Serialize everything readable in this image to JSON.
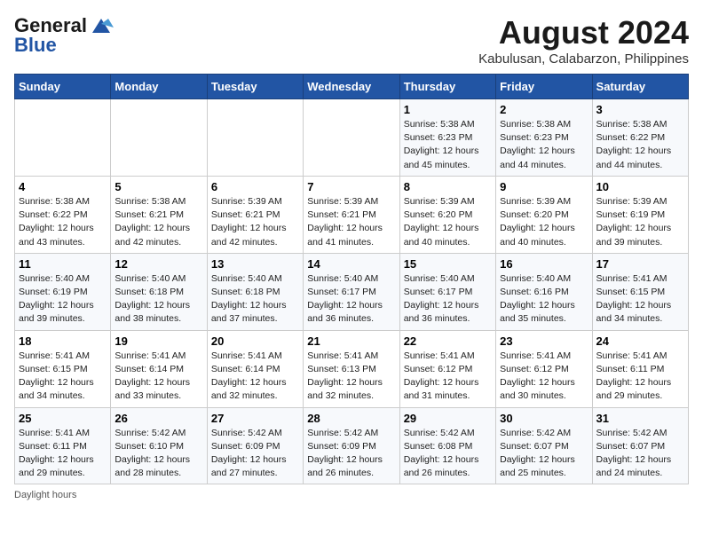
{
  "header": {
    "logo_general": "General",
    "logo_blue": "Blue",
    "month_title": "August 2024",
    "location": "Kabulusan, Calabarzon, Philippines"
  },
  "days_of_week": [
    "Sunday",
    "Monday",
    "Tuesday",
    "Wednesday",
    "Thursday",
    "Friday",
    "Saturday"
  ],
  "footer": {
    "daylight_hours": "Daylight hours"
  },
  "weeks": [
    [
      {
        "day": "",
        "info": ""
      },
      {
        "day": "",
        "info": ""
      },
      {
        "day": "",
        "info": ""
      },
      {
        "day": "",
        "info": ""
      },
      {
        "day": "1",
        "info": "Sunrise: 5:38 AM\nSunset: 6:23 PM\nDaylight: 12 hours\nand 45 minutes."
      },
      {
        "day": "2",
        "info": "Sunrise: 5:38 AM\nSunset: 6:23 PM\nDaylight: 12 hours\nand 44 minutes."
      },
      {
        "day": "3",
        "info": "Sunrise: 5:38 AM\nSunset: 6:22 PM\nDaylight: 12 hours\nand 44 minutes."
      }
    ],
    [
      {
        "day": "4",
        "info": "Sunrise: 5:38 AM\nSunset: 6:22 PM\nDaylight: 12 hours\nand 43 minutes."
      },
      {
        "day": "5",
        "info": "Sunrise: 5:38 AM\nSunset: 6:21 PM\nDaylight: 12 hours\nand 42 minutes."
      },
      {
        "day": "6",
        "info": "Sunrise: 5:39 AM\nSunset: 6:21 PM\nDaylight: 12 hours\nand 42 minutes."
      },
      {
        "day": "7",
        "info": "Sunrise: 5:39 AM\nSunset: 6:21 PM\nDaylight: 12 hours\nand 41 minutes."
      },
      {
        "day": "8",
        "info": "Sunrise: 5:39 AM\nSunset: 6:20 PM\nDaylight: 12 hours\nand 40 minutes."
      },
      {
        "day": "9",
        "info": "Sunrise: 5:39 AM\nSunset: 6:20 PM\nDaylight: 12 hours\nand 40 minutes."
      },
      {
        "day": "10",
        "info": "Sunrise: 5:39 AM\nSunset: 6:19 PM\nDaylight: 12 hours\nand 39 minutes."
      }
    ],
    [
      {
        "day": "11",
        "info": "Sunrise: 5:40 AM\nSunset: 6:19 PM\nDaylight: 12 hours\nand 39 minutes."
      },
      {
        "day": "12",
        "info": "Sunrise: 5:40 AM\nSunset: 6:18 PM\nDaylight: 12 hours\nand 38 minutes."
      },
      {
        "day": "13",
        "info": "Sunrise: 5:40 AM\nSunset: 6:18 PM\nDaylight: 12 hours\nand 37 minutes."
      },
      {
        "day": "14",
        "info": "Sunrise: 5:40 AM\nSunset: 6:17 PM\nDaylight: 12 hours\nand 36 minutes."
      },
      {
        "day": "15",
        "info": "Sunrise: 5:40 AM\nSunset: 6:17 PM\nDaylight: 12 hours\nand 36 minutes."
      },
      {
        "day": "16",
        "info": "Sunrise: 5:40 AM\nSunset: 6:16 PM\nDaylight: 12 hours\nand 35 minutes."
      },
      {
        "day": "17",
        "info": "Sunrise: 5:41 AM\nSunset: 6:15 PM\nDaylight: 12 hours\nand 34 minutes."
      }
    ],
    [
      {
        "day": "18",
        "info": "Sunrise: 5:41 AM\nSunset: 6:15 PM\nDaylight: 12 hours\nand 34 minutes."
      },
      {
        "day": "19",
        "info": "Sunrise: 5:41 AM\nSunset: 6:14 PM\nDaylight: 12 hours\nand 33 minutes."
      },
      {
        "day": "20",
        "info": "Sunrise: 5:41 AM\nSunset: 6:14 PM\nDaylight: 12 hours\nand 32 minutes."
      },
      {
        "day": "21",
        "info": "Sunrise: 5:41 AM\nSunset: 6:13 PM\nDaylight: 12 hours\nand 32 minutes."
      },
      {
        "day": "22",
        "info": "Sunrise: 5:41 AM\nSunset: 6:12 PM\nDaylight: 12 hours\nand 31 minutes."
      },
      {
        "day": "23",
        "info": "Sunrise: 5:41 AM\nSunset: 6:12 PM\nDaylight: 12 hours\nand 30 minutes."
      },
      {
        "day": "24",
        "info": "Sunrise: 5:41 AM\nSunset: 6:11 PM\nDaylight: 12 hours\nand 29 minutes."
      }
    ],
    [
      {
        "day": "25",
        "info": "Sunrise: 5:41 AM\nSunset: 6:11 PM\nDaylight: 12 hours\nand 29 minutes."
      },
      {
        "day": "26",
        "info": "Sunrise: 5:42 AM\nSunset: 6:10 PM\nDaylight: 12 hours\nand 28 minutes."
      },
      {
        "day": "27",
        "info": "Sunrise: 5:42 AM\nSunset: 6:09 PM\nDaylight: 12 hours\nand 27 minutes."
      },
      {
        "day": "28",
        "info": "Sunrise: 5:42 AM\nSunset: 6:09 PM\nDaylight: 12 hours\nand 26 minutes."
      },
      {
        "day": "29",
        "info": "Sunrise: 5:42 AM\nSunset: 6:08 PM\nDaylight: 12 hours\nand 26 minutes."
      },
      {
        "day": "30",
        "info": "Sunrise: 5:42 AM\nSunset: 6:07 PM\nDaylight: 12 hours\nand 25 minutes."
      },
      {
        "day": "31",
        "info": "Sunrise: 5:42 AM\nSunset: 6:07 PM\nDaylight: 12 hours\nand 24 minutes."
      }
    ]
  ]
}
